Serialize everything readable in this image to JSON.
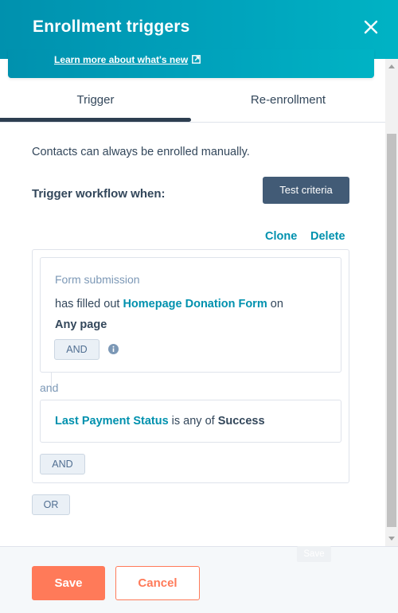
{
  "header": {
    "title": "Enrollment triggers",
    "close_icon": "close-icon",
    "banner_link": "Learn more about what's new",
    "banner_link_icon": "external-link-icon"
  },
  "tabs": [
    {
      "label": "Trigger",
      "active": true
    },
    {
      "label": "Re-enrollment",
      "active": false
    }
  ],
  "content": {
    "manual_note": "Contacts can always be enrolled manually.",
    "trigger_label": "Trigger workflow when:",
    "test_criteria_label": "Test criteria",
    "clone_label": "Clone",
    "delete_label": "Delete",
    "filters": [
      {
        "type": "Form submission",
        "prefix": "has filled out",
        "form_name": "Homepage Donation Form",
        "on": "on",
        "page": "Any page",
        "and_label": "AND",
        "info_icon": "info-icon"
      },
      {
        "property": "Last Payment Status",
        "operator": "is any of",
        "value": "Success"
      }
    ],
    "and_connector": "and",
    "group_and_label": "AND",
    "or_label": "OR"
  },
  "tooltip": {
    "text": "Save"
  },
  "footer": {
    "save_label": "Save",
    "cancel_label": "Cancel"
  },
  "colors": {
    "header_teal": "#00a4bd",
    "link_teal": "#0091ae",
    "primary_orange": "#ff7a59",
    "dark_button": "#425b76",
    "text": "#33475b"
  }
}
